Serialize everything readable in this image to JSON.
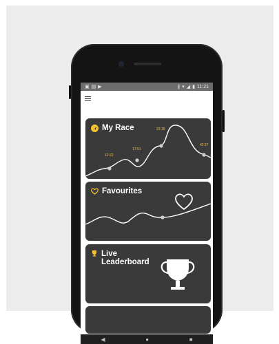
{
  "status_bar": {
    "left_icons": [
      "image-icon",
      "clipboard-icon",
      "play-store-icon"
    ],
    "right_icons": [
      "bluetooth-icon",
      "wifi-icon",
      "signal-icon",
      "battery-icon"
    ],
    "time": "11:21"
  },
  "cards": {
    "my_race": {
      "title": "My Race",
      "icon": "navigation-icon",
      "times": [
        "12:22",
        "17:51",
        "23:19",
        "42:27"
      ]
    },
    "favourites": {
      "title": "Favourites",
      "icon": "heart-icon"
    },
    "leaderboard": {
      "title_line1": "Live",
      "title_line2": "Leaderboard",
      "icon": "trophy-icon"
    }
  },
  "colors": {
    "accent": "#f2c230",
    "card_bg": "#3a3a3a",
    "status_bar": "#6d6d6d"
  },
  "nav_bar": [
    "back-icon",
    "home-icon",
    "recents-icon"
  ]
}
